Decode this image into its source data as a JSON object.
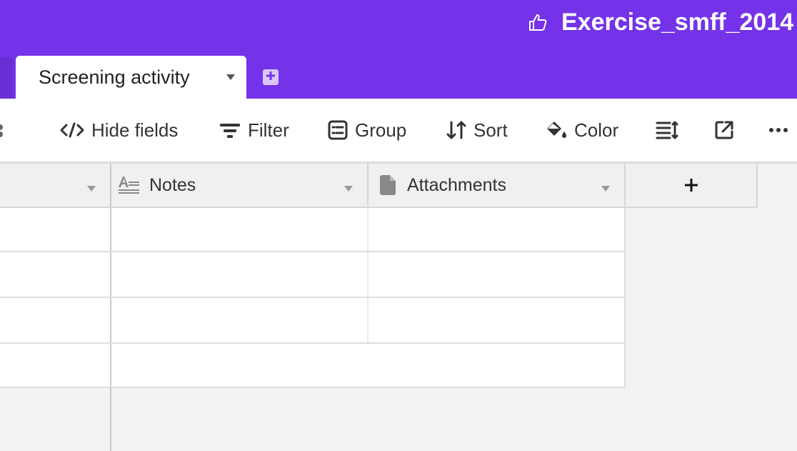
{
  "header": {
    "base_title": "Exercise_smff_2014",
    "tab_active": "Screening activity",
    "colors": {
      "header_bg": "#7433e8",
      "add_table_bg": "#d9c6fb"
    }
  },
  "toolbar": {
    "hide_fields": "Hide fields",
    "filter": "Filter",
    "group": "Group",
    "sort": "Sort",
    "color": "Color"
  },
  "grid": {
    "columns": [
      {
        "name": ""
      },
      {
        "name": "Notes",
        "icon": "long-text-icon"
      },
      {
        "name": "Attachments",
        "icon": "file-icon"
      }
    ],
    "add_column_label": "+",
    "rows": [
      {
        "notes": "",
        "attachments": ""
      },
      {
        "notes": "",
        "attachments": ""
      },
      {
        "notes": "",
        "attachments": ""
      }
    ]
  }
}
